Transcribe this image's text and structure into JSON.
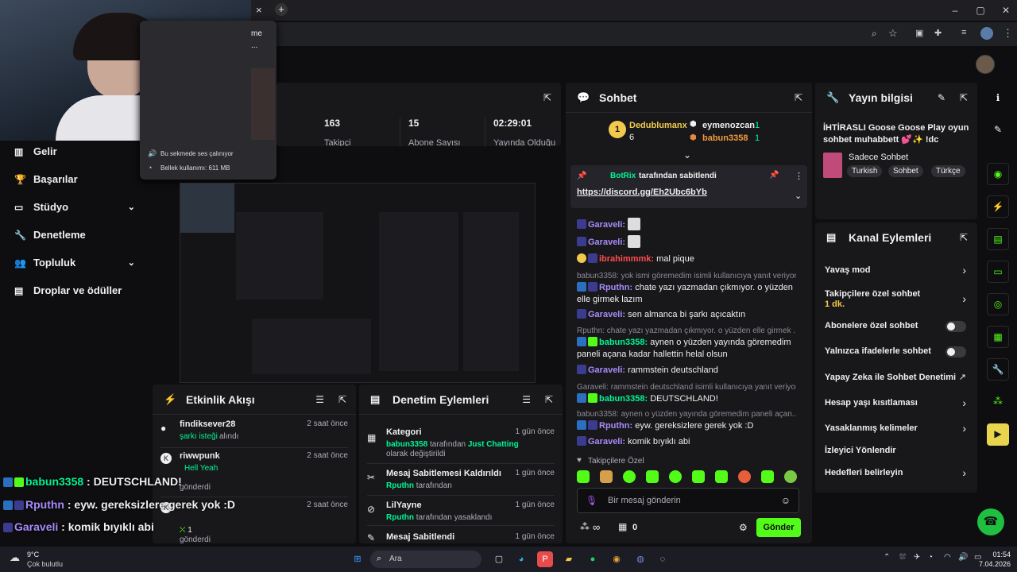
{
  "browser": {
    "tab_menu_title": "me",
    "tab_menu_sub": "...",
    "tooltip_audio": "Bu sekmede ses çalınıyor",
    "tooltip_memory": "Bellek kullanımı: 611 MB",
    "close_glyph": "×",
    "newtab_glyph": "+"
  },
  "nav": {
    "items": [
      {
        "label": "Gelir",
        "icon": "bar-chart-icon"
      },
      {
        "label": "Başarılar",
        "icon": "trophy-icon"
      },
      {
        "label": "Stüdyo",
        "icon": "studio-icon"
      },
      {
        "label": "Denetleme",
        "icon": "wrench-icon"
      },
      {
        "label": "Topluluk",
        "icon": "community-icon"
      },
      {
        "label": "Droplar ve ödüller",
        "icon": "gift-icon"
      }
    ]
  },
  "stats": [
    {
      "value": "163",
      "label": "Takipçi"
    },
    {
      "value": "15",
      "label": "Abone Sayısı"
    },
    {
      "value": "02:29:01",
      "label": "Yayında Olduğu"
    }
  ],
  "activity": {
    "title": "Etkinlik Akışı",
    "items": [
      {
        "user": "findiksever28",
        "text": "şarkı isteği",
        "suffix": "alındı",
        "time": "2 saat önce"
      },
      {
        "user": "riwwpunk",
        "text": "Hell Yeah",
        "suffix": "gönderdi",
        "time": "2 saat önce"
      },
      {
        "user": "Hell Yeah",
        "count": "1",
        "suffix": "gönderdi",
        "time": "2 saat önce"
      }
    ]
  },
  "moderation": {
    "title": "Denetim Eylemleri",
    "items": [
      {
        "title": "Kategori",
        "actor": "babun3358",
        "mid": "tarafından",
        "target": "Just Chatting",
        "tail": "olarak değiştirildi",
        "time": "1 gün önce"
      },
      {
        "title": "Mesaj Sabitlemesi Kaldırıldı",
        "actor": "Rputhn",
        "mid": "tarafından",
        "time": "1 gün önce"
      },
      {
        "title": "LilYayne",
        "actor": "Rputhn",
        "mid": "tarafından yasaklandı",
        "time": "1 gün önce"
      },
      {
        "title": "Mesaj Sabitlendi",
        "time": "1 gün önce"
      }
    ]
  },
  "chat": {
    "title": "Sohbet",
    "leaders": [
      {
        "name": "Dedublumanx",
        "count": "6"
      },
      {
        "name": "eymenozcan",
        "count": "1"
      },
      {
        "name": "babun3358",
        "count": "1"
      }
    ],
    "pinned": {
      "by": "BotRix",
      "by_suffix": "tarafından sabitlendi",
      "link": "https://discord.gg/Eh2Ubc6bYb"
    },
    "messages": [
      {
        "user": "Garaveli:",
        "text": "",
        "color": "#a78bfa"
      },
      {
        "user": "Garaveli:",
        "text": "",
        "color": "#a78bfa"
      },
      {
        "user": "ibrahimmmk:",
        "text": "mal pique",
        "color": "#ff4d4d"
      },
      {
        "reply": "babun3358: yok ismi göremedim isimli kullanıcıya yanıt veriyor",
        "user": "Rputhn:",
        "text": "chate yazı yazmadan çıkmıyor. o yüzden elle girmek lazım",
        "color": "#a78bfa"
      },
      {
        "user": "Garaveli:",
        "text": "sen almanca bi şarkı açıcaktın",
        "color": "#a78bfa"
      },
      {
        "reply": "Rputhn: chate yazı yazmadan çıkmıyor. o yüzden elle girmek ...",
        "user": "babun3358:",
        "text": "aynen o yüzden yayında göremedim paneli açana kadar hallettin helal olsun",
        "color": "#00f593"
      },
      {
        "user": "Garaveli:",
        "text": "rammstein deutschland",
        "color": "#a78bfa"
      },
      {
        "reply": "Garaveli: rammstein deutschland isimli kullanıcıya yanıt veriyor",
        "user": "babun3358:",
        "text": "DEUTSCHLAND!",
        "color": "#00f593"
      },
      {
        "reply": "babun3358: aynen o yüzden yayında göremedim paneli açan...",
        "user": "Rputhn:",
        "text": "eyw. gereksizlere gerek yok :D",
        "color": "#a78bfa"
      },
      {
        "user": "Garaveli:",
        "text": "komik bıyıklı abi",
        "color": "#a78bfa"
      }
    ],
    "followers_only": "Takipçilere Özel",
    "input_placeholder": "Bir mesaj gönderin",
    "viewer_count": "0",
    "send_label": "Gönder",
    "infinity": "∞"
  },
  "stream_info": {
    "title": "Yayın bilgisi",
    "stream_title": "İHTİRASLI Goose Goose Play oyun sohbet muhabbett 💕✨ !dc",
    "category": "Sadece Sohbet",
    "tags": [
      "Turkish",
      "Sohbet",
      "Türkçe"
    ]
  },
  "channel_actions": {
    "title": "Kanal Eylemleri",
    "items": [
      {
        "label": "Yavaş mod",
        "ctrl": "chevron"
      },
      {
        "label": "Takipçilere özel sohbet",
        "sub": "1 dk.",
        "ctrl": "chevron"
      },
      {
        "label": "Abonelere özel sohbet",
        "ctrl": "toggle"
      },
      {
        "label": "Yalnızca ifadelerle sohbet",
        "ctrl": "toggle"
      },
      {
        "label": "Yapay Zeka ile Sohbet Denetimi",
        "ctrl": "external"
      },
      {
        "label": "Hesap yaşı kısıtlaması",
        "ctrl": "chevron"
      },
      {
        "label": "Yasaklanmış kelimeler",
        "ctrl": "chevron"
      },
      {
        "label": "İzleyici Yönlendir",
        "ctrl": "none"
      },
      {
        "label": "Hedefleri belirleyin",
        "ctrl": "chevron"
      }
    ]
  },
  "overlay": [
    {
      "user": "babun3358",
      "text": ": DEUTSCHLAND!",
      "color": "#00f593"
    },
    {
      "user": "Rputhn",
      "text": ": eyw. gereksizlere gerek yok :D",
      "color": "#a78bfa"
    },
    {
      "user": "Garaveli",
      "text": ": komik bıyıklı abi",
      "color": "#a78bfa"
    }
  ],
  "taskbar": {
    "weather_temp": "9°C",
    "weather_desc": "Çok bulutlu",
    "search_placeholder": "Ara",
    "time": "01:54",
    "date": "7.04.2026"
  },
  "colors": {
    "accent": "#53fc18",
    "purple": "#a78bfa",
    "panel": "#18181b"
  }
}
